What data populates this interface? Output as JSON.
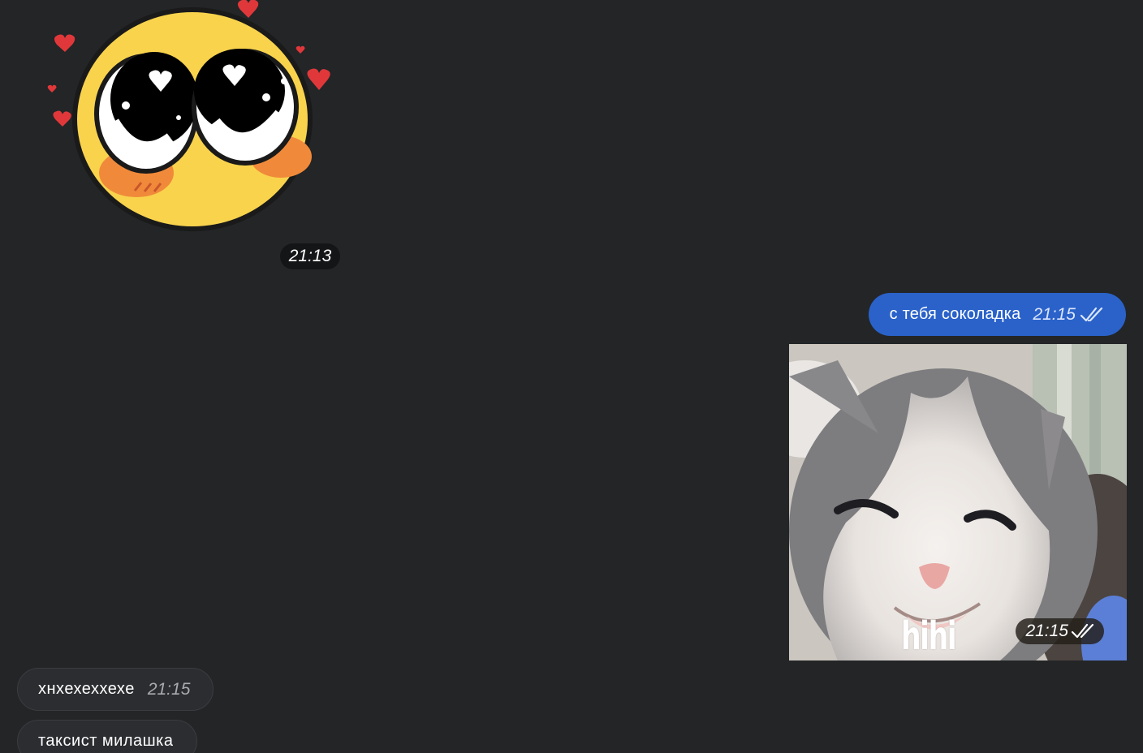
{
  "messages": [
    {
      "id": "sticker",
      "direction": "incoming",
      "type": "sticker",
      "sticker_icon": "cute-blushing-heart-eyes-emoji",
      "time": "21:13"
    },
    {
      "id": "out-text",
      "direction": "outgoing",
      "type": "text",
      "text": "с тебя соколадка",
      "time": "21:15",
      "status_icon": "double-check-read-icon"
    },
    {
      "id": "out-photo",
      "direction": "outgoing",
      "type": "photo",
      "caption_overlay": "hihi",
      "time": "21:15",
      "status_icon": "double-check-read-icon"
    },
    {
      "id": "in-msg-1",
      "direction": "incoming",
      "type": "text",
      "text": "хнхехеххехе",
      "time": "21:15"
    },
    {
      "id": "in-msg-2",
      "direction": "incoming",
      "type": "text",
      "text": "таксист милашка"
    }
  ],
  "colors": {
    "background": "#232527",
    "outgoing_bubble": "#2a62c9",
    "incoming_bubble": "#2b2d30",
    "time_incoming": "#a8abb0"
  }
}
